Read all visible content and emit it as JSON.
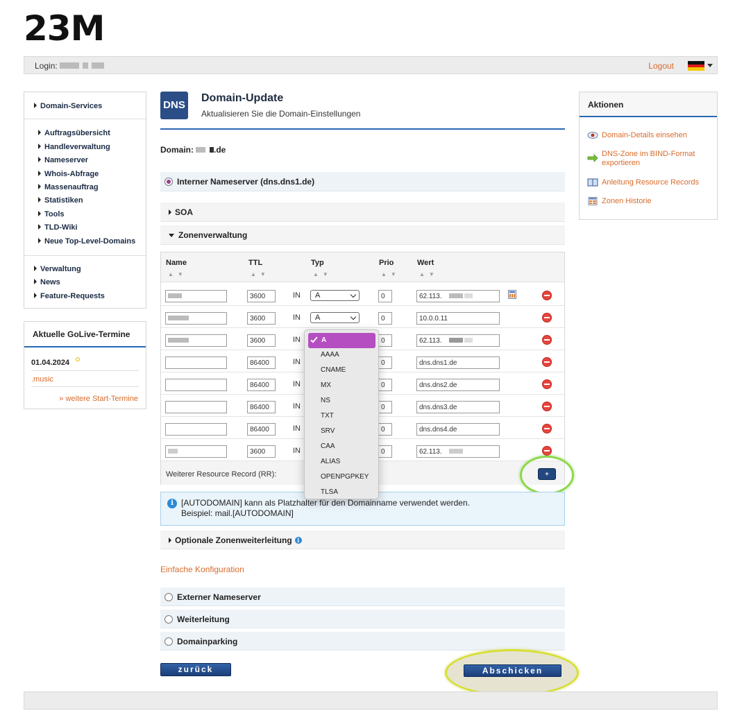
{
  "logo": "23M",
  "topbar": {
    "login_label": "Login:",
    "logout": "Logout"
  },
  "sidebar": {
    "main_item": "Domain-Services",
    "sub_items": [
      "Auftragsübersicht",
      "Handleverwaltung",
      "Nameserver",
      "Whois-Abfrage",
      "Massenauftrag",
      "Statistiken",
      "Tools",
      "TLD-Wiki",
      "Neue Top-Level-Domains"
    ],
    "bottom_items": [
      "Verwaltung",
      "News",
      "Feature-Requests"
    ]
  },
  "golive": {
    "title": "Aktuelle GoLive-Termine",
    "date": "01.04.2024",
    "tld": ".music",
    "more": "» weitere Start-Termine"
  },
  "header": {
    "badge": "DNS",
    "title": "Domain-Update",
    "subtitle": "Aktualisieren Sie die Domain-Einstellungen"
  },
  "domain": {
    "label": "Domain:",
    "suffix": ".de"
  },
  "sections": {
    "internal_ns": "Interner Nameserver (dns.dns1.de)",
    "soa": "SOA",
    "zone": "Zonenverwaltung",
    "optional_forward": "Optionale Zonenweiterleitung"
  },
  "zone_table": {
    "columns": {
      "name": "Name",
      "ttl": "TTL",
      "type": "Typ",
      "prio": "Prio",
      "value": "Wert"
    },
    "in_label": "IN",
    "rows": [
      {
        "ttl": "3600",
        "type": "A",
        "prio": "0",
        "value": "62.113."
      },
      {
        "ttl": "3600",
        "type": "A",
        "prio": "0",
        "value": "10.0.0.11"
      },
      {
        "ttl": "3600",
        "type": "",
        "prio": "0",
        "value": "62.113."
      },
      {
        "ttl": "86400",
        "type": "",
        "prio": "0",
        "value": "dns.dns1.de"
      },
      {
        "ttl": "86400",
        "type": "",
        "prio": "0",
        "value": "dns.dns2.de"
      },
      {
        "ttl": "86400",
        "type": "",
        "prio": "0",
        "value": "dns.dns3.de"
      },
      {
        "ttl": "86400",
        "type": "",
        "prio": "0",
        "value": "dns.dns4.de"
      },
      {
        "ttl": "3600",
        "type": "",
        "prio": "0",
        "value": "62.113."
      }
    ],
    "rr_label": "Weiterer Resource Record (RR):",
    "plus": "+"
  },
  "dropdown": {
    "selected": "A",
    "options": [
      "AAAA",
      "CNAME",
      "MX",
      "NS",
      "TXT",
      "SRV",
      "CAA",
      "ALIAS",
      "OPENPGPKEY",
      "TLSA"
    ]
  },
  "info": {
    "icon": "i",
    "line1": "[AUTODOMAIN] kann als Platzhalter für den Domainname verwendet werden.",
    "line2": "Beispiel: mail.[AUTODOMAIN]"
  },
  "simple_config": "Einfache Konfiguration",
  "options": [
    "Externer Nameserver",
    "Weiterleitung",
    "Domainparking"
  ],
  "buttons": {
    "back": "zurück",
    "submit": "Abschicken"
  },
  "actions": {
    "title": "Aktionen",
    "links": [
      "Domain-Details einsehen",
      "DNS-Zone im BIND-Format exportieren",
      "Anleitung Resource Records",
      "Zonen Historie"
    ]
  },
  "colors": {
    "accent_blue": "#2a66b4",
    "link_orange": "#d86b2c",
    "button_navy": "#23477e",
    "selected_purple": "#b54ec1"
  }
}
